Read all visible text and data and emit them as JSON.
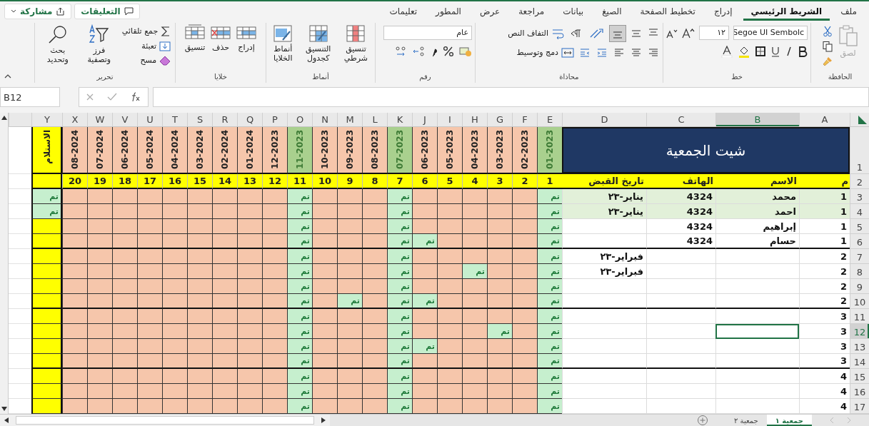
{
  "menu_tabs": [
    {
      "label": "ملف",
      "selected": false
    },
    {
      "label": "الشريط الرئيسي",
      "selected": true
    },
    {
      "label": "إدراج",
      "selected": false
    },
    {
      "label": "تخطيط الصفحة",
      "selected": false
    },
    {
      "label": "الصيغ",
      "selected": false
    },
    {
      "label": "بيانات",
      "selected": false
    },
    {
      "label": "مراجعة",
      "selected": false
    },
    {
      "label": "عرض",
      "selected": false
    },
    {
      "label": "المطور",
      "selected": false
    },
    {
      "label": "تعليمات",
      "selected": false
    }
  ],
  "comments_button": "التعليقات",
  "share_button": "مشاركة",
  "ribbon": {
    "clipboard": {
      "label": "الحافظة",
      "paste": "لصق",
      "paste_disabled": true
    },
    "font": {
      "label": "خط",
      "font_name": "Segoe UI Sembolc",
      "font_size": "١٢"
    },
    "alignment": {
      "label": "محاذاة",
      "wrap_text": "التفاف النص",
      "merge_center": "دمج وتوسيط",
      "middle_align_selected": true
    },
    "number": {
      "label": "رقم",
      "format": "عام"
    },
    "styles": {
      "label": "أنماط",
      "conditional": "تنسيق شرطي",
      "as_table": "التنسيق كجدول",
      "cell_styles": "أنماط الخلايا"
    },
    "cells": {
      "label": "خلايا",
      "insert": "إدراج",
      "delete": "حذف",
      "format": "تنسيق"
    },
    "editing": {
      "label": "تحرير",
      "autosum": "جمع تلقائي",
      "fill": "تعبئة",
      "clear": "مسح",
      "sort_filter": "فرز وتصفية",
      "find_select": "بحث وتحديد"
    }
  },
  "formula_bar": {
    "name_box": "B12"
  },
  "sheet": {
    "columns": [
      {
        "label": "A",
        "selected": false
      },
      {
        "label": "B",
        "selected": true
      },
      {
        "label": "C",
        "selected": false
      },
      {
        "label": "D",
        "selected": false
      },
      {
        "label": "E",
        "selected": false
      },
      {
        "label": "F",
        "selected": false
      },
      {
        "label": "G",
        "selected": false
      },
      {
        "label": "H",
        "selected": false
      },
      {
        "label": "I",
        "selected": false
      },
      {
        "label": "J",
        "selected": false
      },
      {
        "label": "K",
        "selected": false
      },
      {
        "label": "L",
        "selected": false
      },
      {
        "label": "M",
        "selected": false
      },
      {
        "label": "N",
        "selected": false
      },
      {
        "label": "O",
        "selected": false
      },
      {
        "label": "P",
        "selected": false
      },
      {
        "label": "Q",
        "selected": false
      },
      {
        "label": "R",
        "selected": false
      },
      {
        "label": "S",
        "selected": false
      },
      {
        "label": "T",
        "selected": false
      },
      {
        "label": "U",
        "selected": false
      },
      {
        "label": "V",
        "selected": false
      },
      {
        "label": "W",
        "selected": false
      },
      {
        "label": "X",
        "selected": false
      },
      {
        "label": "Y",
        "selected": false
      }
    ],
    "title_row": "1",
    "header_row": "2",
    "title": "شيت الجمعية",
    "headers": [
      "م",
      "الاسم",
      "الهاتف",
      "تاريخ القبض"
    ],
    "receipt_header": "الاستلام",
    "months": [
      {
        "label": "01-2023",
        "complete": true
      },
      {
        "label": "02-2023",
        "complete": false
      },
      {
        "label": "03-2023",
        "complete": false
      },
      {
        "label": "04-2023",
        "complete": false
      },
      {
        "label": "05-2023",
        "complete": false
      },
      {
        "label": "06-2023",
        "complete": false
      },
      {
        "label": "07-2023",
        "complete": true
      },
      {
        "label": "08-2023",
        "complete": false
      },
      {
        "label": "09-2023",
        "complete": false
      },
      {
        "label": "10-2023",
        "complete": false
      },
      {
        "label": "11-2023",
        "complete": true
      },
      {
        "label": "12-2023",
        "complete": false
      },
      {
        "label": "01-2024",
        "complete": false
      },
      {
        "label": "02-2024",
        "complete": false
      },
      {
        "label": "03-2024",
        "complete": false
      },
      {
        "label": "04-2024",
        "complete": false
      },
      {
        "label": "05-2024",
        "complete": false
      },
      {
        "label": "06-2024",
        "complete": false
      },
      {
        "label": "07-2024",
        "complete": false
      },
      {
        "label": "08-2024",
        "complete": false
      }
    ],
    "month_numbers": [
      "1",
      "2",
      "3",
      "4",
      "5",
      "6",
      "7",
      "8",
      "9",
      "10",
      "11",
      "12",
      "13",
      "14",
      "15",
      "16",
      "17",
      "18",
      "19",
      "20"
    ],
    "rows": [
      {
        "row": "3",
        "no": "1",
        "name": "محمد",
        "phone": "4324",
        "date": "يناير-٢٣",
        "received": true,
        "receipt": "تم",
        "group_end": false,
        "selected": false,
        "cells": [
          {
            "paid": true,
            "text": "تم"
          },
          {
            "paid": false
          },
          {
            "paid": false
          },
          {
            "paid": false
          },
          {
            "paid": false
          },
          {
            "paid": false
          },
          {
            "paid": true,
            "text": "تم"
          },
          {
            "paid": false
          },
          {
            "paid": false
          },
          {
            "paid": false
          },
          {
            "paid": true,
            "text": "تم"
          },
          {
            "paid": false
          },
          {
            "paid": false
          },
          {
            "paid": false
          },
          {
            "paid": false
          },
          {
            "paid": false
          },
          {
            "paid": false
          },
          {
            "paid": false
          },
          {
            "paid": false
          },
          {
            "paid": false
          }
        ]
      },
      {
        "row": "4",
        "no": "1",
        "name": "احمد",
        "phone": "4324",
        "date": "يناير-٢٣",
        "received": true,
        "receipt": "تم",
        "group_end": false,
        "selected": false,
        "cells": [
          {
            "paid": true,
            "text": "تم"
          },
          {
            "paid": false
          },
          {
            "paid": false
          },
          {
            "paid": false
          },
          {
            "paid": false
          },
          {
            "paid": false
          },
          {
            "paid": true,
            "text": "تم"
          },
          {
            "paid": false
          },
          {
            "paid": false
          },
          {
            "paid": false
          },
          {
            "paid": true,
            "text": "تم"
          },
          {
            "paid": false
          },
          {
            "paid": false
          },
          {
            "paid": false
          },
          {
            "paid": false
          },
          {
            "paid": false
          },
          {
            "paid": false
          },
          {
            "paid": false
          },
          {
            "paid": false
          },
          {
            "paid": false
          }
        ]
      },
      {
        "row": "5",
        "no": "1",
        "name": "إبراهيم",
        "phone": "4324",
        "received": false,
        "group_end": false,
        "selected": false,
        "cells": [
          {
            "paid": true,
            "text": "تم"
          },
          {
            "paid": false
          },
          {
            "paid": false
          },
          {
            "paid": false
          },
          {
            "paid": false
          },
          {
            "paid": false
          },
          {
            "paid": true,
            "text": "تم"
          },
          {
            "paid": false
          },
          {
            "paid": false
          },
          {
            "paid": false
          },
          {
            "paid": true,
            "text": "تم"
          },
          {
            "paid": false
          },
          {
            "paid": false
          },
          {
            "paid": false
          },
          {
            "paid": false
          },
          {
            "paid": false
          },
          {
            "paid": false
          },
          {
            "paid": false
          },
          {
            "paid": false
          },
          {
            "paid": false
          }
        ]
      },
      {
        "row": "6",
        "no": "1",
        "name": "حسام",
        "phone": "4324",
        "received": false,
        "group_end": true,
        "selected": false,
        "cells": [
          {
            "paid": true,
            "text": "تم"
          },
          {
            "paid": false
          },
          {
            "paid": false
          },
          {
            "paid": false
          },
          {
            "paid": false
          },
          {
            "paid": true,
            "text": "تم"
          },
          {
            "paid": true,
            "text": "تم"
          },
          {
            "paid": false
          },
          {
            "paid": false
          },
          {
            "paid": false
          },
          {
            "paid": true,
            "text": "تم"
          },
          {
            "paid": false
          },
          {
            "paid": false
          },
          {
            "paid": false
          },
          {
            "paid": false
          },
          {
            "paid": false
          },
          {
            "paid": false
          },
          {
            "paid": false
          },
          {
            "paid": false
          },
          {
            "paid": false
          }
        ]
      },
      {
        "row": "7",
        "no": "2",
        "date": "فبراير-٢٣",
        "received": false,
        "group_end": false,
        "selected": false,
        "cells": [
          {
            "paid": true,
            "text": "تم"
          },
          {
            "paid": false
          },
          {
            "paid": false
          },
          {
            "paid": false
          },
          {
            "paid": false
          },
          {
            "paid": false
          },
          {
            "paid": true,
            "text": "تم"
          },
          {
            "paid": false
          },
          {
            "paid": false
          },
          {
            "paid": false
          },
          {
            "paid": true,
            "text": "تم"
          },
          {
            "paid": false
          },
          {
            "paid": false
          },
          {
            "paid": false
          },
          {
            "paid": false
          },
          {
            "paid": false
          },
          {
            "paid": false
          },
          {
            "paid": false
          },
          {
            "paid": false
          },
          {
            "paid": false
          }
        ]
      },
      {
        "row": "8",
        "no": "2",
        "date": "فبراير-٢٣",
        "received": false,
        "group_end": false,
        "selected": false,
        "cells": [
          {
            "paid": true,
            "text": "تم"
          },
          {
            "paid": false
          },
          {
            "paid": false
          },
          {
            "paid": true,
            "text": "تم"
          },
          {
            "paid": false
          },
          {
            "paid": false
          },
          {
            "paid": true,
            "text": "تم"
          },
          {
            "paid": false
          },
          {
            "paid": false
          },
          {
            "paid": false
          },
          {
            "paid": true,
            "text": "تم"
          },
          {
            "paid": false
          },
          {
            "paid": false
          },
          {
            "paid": false
          },
          {
            "paid": false
          },
          {
            "paid": false
          },
          {
            "paid": false
          },
          {
            "paid": false
          },
          {
            "paid": false
          },
          {
            "paid": false
          }
        ]
      },
      {
        "row": "9",
        "no": "2",
        "received": false,
        "group_end": false,
        "selected": false,
        "cells": [
          {
            "paid": true,
            "text": "تم"
          },
          {
            "paid": false
          },
          {
            "paid": false
          },
          {
            "paid": false
          },
          {
            "paid": false
          },
          {
            "paid": false
          },
          {
            "paid": true,
            "text": "تم"
          },
          {
            "paid": false
          },
          {
            "paid": false
          },
          {
            "paid": false
          },
          {
            "paid": true,
            "text": "تم"
          },
          {
            "paid": false
          },
          {
            "paid": false
          },
          {
            "paid": false
          },
          {
            "paid": false
          },
          {
            "paid": false
          },
          {
            "paid": false
          },
          {
            "paid": false
          },
          {
            "paid": false
          },
          {
            "paid": false
          }
        ]
      },
      {
        "row": "10",
        "no": "2",
        "received": false,
        "group_end": true,
        "selected": false,
        "cells": [
          {
            "paid": true,
            "text": "تم"
          },
          {
            "paid": false
          },
          {
            "paid": false
          },
          {
            "paid": false
          },
          {
            "paid": false
          },
          {
            "paid": true,
            "text": "تم"
          },
          {
            "paid": true,
            "text": "تم"
          },
          {
            "paid": false
          },
          {
            "paid": true,
            "text": "تم"
          },
          {
            "paid": false
          },
          {
            "paid": true,
            "text": "تم"
          },
          {
            "paid": false
          },
          {
            "paid": false
          },
          {
            "paid": false
          },
          {
            "paid": false
          },
          {
            "paid": false
          },
          {
            "paid": false
          },
          {
            "paid": false
          },
          {
            "paid": false
          },
          {
            "paid": false
          }
        ]
      },
      {
        "row": "11",
        "no": "3",
        "received": false,
        "group_end": false,
        "selected": false,
        "cells": [
          {
            "paid": true,
            "text": "تم"
          },
          {
            "paid": false
          },
          {
            "paid": false
          },
          {
            "paid": false
          },
          {
            "paid": false
          },
          {
            "paid": false
          },
          {
            "paid": true,
            "text": "تم"
          },
          {
            "paid": false
          },
          {
            "paid": false
          },
          {
            "paid": false
          },
          {
            "paid": true,
            "text": "تم"
          },
          {
            "paid": false
          },
          {
            "paid": false
          },
          {
            "paid": false
          },
          {
            "paid": false
          },
          {
            "paid": false
          },
          {
            "paid": false
          },
          {
            "paid": false
          },
          {
            "paid": false
          },
          {
            "paid": false
          }
        ]
      },
      {
        "row": "12",
        "no": "3",
        "received": false,
        "group_end": false,
        "selected": true,
        "cells": [
          {
            "paid": true,
            "text": "تم"
          },
          {
            "paid": false
          },
          {
            "paid": true,
            "text": "تم"
          },
          {
            "paid": false
          },
          {
            "paid": false
          },
          {
            "paid": false
          },
          {
            "paid": true,
            "text": "تم"
          },
          {
            "paid": false
          },
          {
            "paid": false
          },
          {
            "paid": false
          },
          {
            "paid": true,
            "text": "تم"
          },
          {
            "paid": false
          },
          {
            "paid": false
          },
          {
            "paid": false
          },
          {
            "paid": false
          },
          {
            "paid": false
          },
          {
            "paid": false
          },
          {
            "paid": false
          },
          {
            "paid": false
          },
          {
            "paid": false
          }
        ]
      },
      {
        "row": "13",
        "no": "3",
        "received": false,
        "group_end": false,
        "selected": false,
        "cells": [
          {
            "paid": true,
            "text": "تم"
          },
          {
            "paid": false
          },
          {
            "paid": false
          },
          {
            "paid": false
          },
          {
            "paid": false
          },
          {
            "paid": true,
            "text": "تم"
          },
          {
            "paid": true,
            "text": "تم"
          },
          {
            "paid": false
          },
          {
            "paid": false
          },
          {
            "paid": false
          },
          {
            "paid": true,
            "text": "تم"
          },
          {
            "paid": false
          },
          {
            "paid": false
          },
          {
            "paid": false
          },
          {
            "paid": false
          },
          {
            "paid": false
          },
          {
            "paid": false
          },
          {
            "paid": false
          },
          {
            "paid": false
          },
          {
            "paid": false
          }
        ]
      },
      {
        "row": "14",
        "no": "3",
        "received": false,
        "group_end": true,
        "selected": false,
        "cells": [
          {
            "paid": true,
            "text": "تم"
          },
          {
            "paid": false
          },
          {
            "paid": false
          },
          {
            "paid": false
          },
          {
            "paid": false
          },
          {
            "paid": false
          },
          {
            "paid": true,
            "text": "تم"
          },
          {
            "paid": false
          },
          {
            "paid": false
          },
          {
            "paid": false
          },
          {
            "paid": true,
            "text": "تم"
          },
          {
            "paid": false
          },
          {
            "paid": false
          },
          {
            "paid": false
          },
          {
            "paid": false
          },
          {
            "paid": false
          },
          {
            "paid": false
          },
          {
            "paid": false
          },
          {
            "paid": false
          },
          {
            "paid": false
          }
        ]
      },
      {
        "row": "15",
        "no": "4",
        "received": false,
        "group_end": false,
        "selected": false,
        "cells": [
          {
            "paid": true,
            "text": "تم"
          },
          {
            "paid": false
          },
          {
            "paid": false
          },
          {
            "paid": false
          },
          {
            "paid": false
          },
          {
            "paid": false
          },
          {
            "paid": true,
            "text": "تم"
          },
          {
            "paid": false
          },
          {
            "paid": false
          },
          {
            "paid": false
          },
          {
            "paid": true,
            "text": "تم"
          },
          {
            "paid": false
          },
          {
            "paid": false
          },
          {
            "paid": false
          },
          {
            "paid": false
          },
          {
            "paid": false
          },
          {
            "paid": false
          },
          {
            "paid": false
          },
          {
            "paid": false
          },
          {
            "paid": false
          }
        ]
      },
      {
        "row": "16",
        "no": "4",
        "received": false,
        "group_end": false,
        "selected": false,
        "cells": [
          {
            "paid": true,
            "text": "تم"
          },
          {
            "paid": false
          },
          {
            "paid": false
          },
          {
            "paid": false
          },
          {
            "paid": false
          },
          {
            "paid": false
          },
          {
            "paid": true,
            "text": "تم"
          },
          {
            "paid": false
          },
          {
            "paid": false
          },
          {
            "paid": false
          },
          {
            "paid": true,
            "text": "تم"
          },
          {
            "paid": false
          },
          {
            "paid": false
          },
          {
            "paid": false
          },
          {
            "paid": false
          },
          {
            "paid": false
          },
          {
            "paid": false
          },
          {
            "paid": false
          },
          {
            "paid": false
          },
          {
            "paid": false
          }
        ]
      },
      {
        "row": "17",
        "no": "4",
        "received": false,
        "group_end": false,
        "selected": false,
        "cells": [
          {
            "paid": true,
            "text": "تم"
          },
          {
            "paid": false
          },
          {
            "paid": false
          },
          {
            "paid": false
          },
          {
            "paid": false
          },
          {
            "paid": false
          },
          {
            "paid": true,
            "text": "تم"
          },
          {
            "paid": false
          },
          {
            "paid": false
          },
          {
            "paid": false
          },
          {
            "paid": true,
            "text": "تم"
          },
          {
            "paid": false
          },
          {
            "paid": false
          },
          {
            "paid": false
          },
          {
            "paid": false
          },
          {
            "paid": false
          },
          {
            "paid": false
          },
          {
            "paid": false
          },
          {
            "paid": false
          },
          {
            "paid": false
          }
        ]
      }
    ]
  },
  "sheet_tabs": [
    {
      "label": "جمعية ١",
      "selected": true
    },
    {
      "label": "جمعية ٢",
      "selected": false
    }
  ]
}
